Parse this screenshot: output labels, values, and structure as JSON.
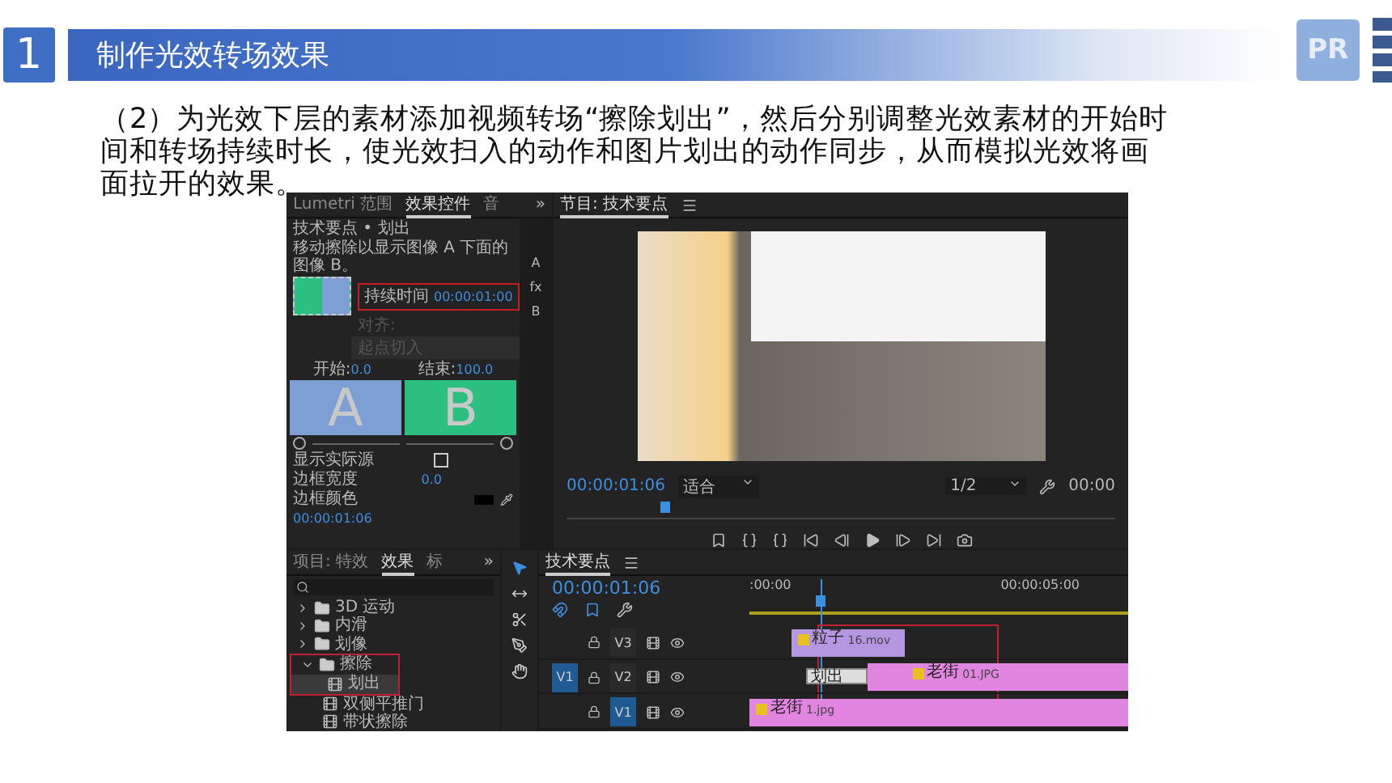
{
  "slide": {
    "number": "1",
    "title": "制作光效转场效果",
    "logo": "PR",
    "paragraph": "（2）为光效下层的素材添加视频转场“擦除划出”，然后分别调整光效素材的开始时间和转场持续时长，使光效扫入的动作和图片划出的动作同步，从而模拟光效将画面拉开的效果。"
  },
  "effect_controls": {
    "tabs": [
      {
        "label": "Lumetri 范围",
        "selected": false
      },
      {
        "label": "效果控件",
        "selected": true
      },
      {
        "label": "音",
        "selected": false
      }
    ],
    "more": "»",
    "clip": "技术要点 • 划出",
    "description": "移动擦除以显示图像 A 下面的图像 B。",
    "track_labels": [
      "A",
      "fx",
      "B"
    ],
    "duration_label": "持续时间",
    "duration": "00:00:01:00",
    "align_label": "对齐:",
    "align_value": "起点切入",
    "start_label": "开始:",
    "start": "0.0",
    "end_label": "结束:",
    "end": "100.0",
    "a": "A",
    "b": "B",
    "properties": [
      {
        "kind": "checkbox",
        "label": "显示实际源",
        "checked": false
      },
      {
        "kind": "value",
        "label": "边框宽度",
        "value": "0.0"
      },
      {
        "kind": "swatch",
        "label": "边框颜色"
      }
    ],
    "time": "00:00:01:06"
  },
  "program": {
    "title": "节目: 技术要点",
    "time": "00:00:01:06",
    "fit": "适合",
    "resolution": "1/2",
    "time_right": "00:00",
    "level": 0.18
  },
  "effects": {
    "tabs": [
      {
        "label": "项目: 特效",
        "selected": false
      },
      {
        "label": "效果",
        "selected": true
      },
      {
        "label": "标",
        "selected": false
      }
    ],
    "more": "»",
    "tree": [
      {
        "label": "3D 运动",
        "expanded": false,
        "selected": false
      },
      {
        "label": "内滑",
        "expanded": false,
        "selected": false
      },
      {
        "label": "划像",
        "expanded": false,
        "selected": false
      },
      {
        "label": "擦除",
        "expanded": true,
        "selected": false,
        "children": [
          {
            "label": "划出",
            "selected": true
          },
          {
            "label": "双侧平推门",
            "selected": false
          },
          {
            "label": "带状擦除",
            "selected": false
          }
        ]
      }
    ]
  },
  "timeline": {
    "title": "技术要点",
    "time": "00:00:01:06",
    "ruler": [
      ":00:00",
      "00:00:05:00"
    ],
    "level": 0.19,
    "tracks": [
      {
        "name": "V3",
        "targeted": false,
        "clips": [
          {
            "kind": "clip",
            "label": "粒子",
            "detail": "16.mov",
            "color": "#b497e0"
          }
        ]
      },
      {
        "name": "V2",
        "targeted": false,
        "source_patch": "V1",
        "clips": [
          {
            "kind": "transition",
            "label": "划出"
          },
          {
            "kind": "clip",
            "label": "老街",
            "detail": "01.JPG",
            "color": "#e285e0"
          }
        ]
      },
      {
        "name": "V1",
        "targeted": true,
        "clips": [
          {
            "kind": "clip",
            "label": "老街",
            "detail": "1.jpg",
            "color": "#e285e0"
          }
        ]
      }
    ]
  }
}
